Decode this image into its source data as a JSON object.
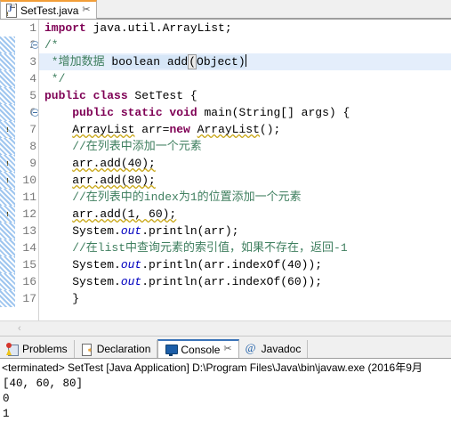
{
  "editor": {
    "tab": {
      "label": "SetTest.java",
      "close_glyph": "✂",
      "icon": "java-file-warning-icon"
    },
    "lines": [
      {
        "n": "1",
        "fold": false,
        "warn": false,
        "diff": false,
        "hl": false,
        "tokens": [
          {
            "t": "import ",
            "c": "kw"
          },
          {
            "t": "java.util.ArrayList;",
            "c": "plain"
          }
        ]
      },
      {
        "n": "2",
        "fold": true,
        "warn": false,
        "diff": true,
        "hl": false,
        "tokens": [
          {
            "t": "/*",
            "c": "cmt"
          }
        ]
      },
      {
        "n": "3",
        "fold": false,
        "warn": false,
        "diff": true,
        "hl": true,
        "tokens": [
          {
            "t": " *增加数据 ",
            "c": "cmt"
          },
          {
            "t": "boolean add",
            "c": "sel-plainblue"
          },
          {
            "t": "(",
            "c": "sel-mbox"
          },
          {
            "t": "Object)",
            "c": "sel-plainblue"
          },
          {
            "t": "|",
            "c": "caret"
          }
        ]
      },
      {
        "n": "4",
        "fold": false,
        "warn": false,
        "diff": true,
        "hl": false,
        "tokens": [
          {
            "t": " */",
            "c": "cmt"
          }
        ]
      },
      {
        "n": "5",
        "fold": false,
        "warn": false,
        "diff": true,
        "hl": false,
        "tokens": [
          {
            "t": "public class ",
            "c": "kw"
          },
          {
            "t": "SetTest {",
            "c": "plain"
          }
        ]
      },
      {
        "n": "6",
        "fold": true,
        "warn": false,
        "diff": true,
        "hl": false,
        "tokens": [
          {
            "t": "    ",
            "c": "plain"
          },
          {
            "t": "public static void ",
            "c": "kw"
          },
          {
            "t": "main(String[] args) {",
            "c": "plain"
          }
        ]
      },
      {
        "n": "7",
        "fold": false,
        "warn": true,
        "diff": true,
        "hl": false,
        "tokens": [
          {
            "t": "    ",
            "c": "plain"
          },
          {
            "t": "ArrayList",
            "c": "squig"
          },
          {
            "t": " arr=",
            "c": "plain"
          },
          {
            "t": "new ",
            "c": "kw"
          },
          {
            "t": "ArrayList",
            "c": "squig"
          },
          {
            "t": "();",
            "c": "plain"
          }
        ]
      },
      {
        "n": "8",
        "fold": false,
        "warn": false,
        "diff": true,
        "hl": false,
        "tokens": [
          {
            "t": "    //在列表中添加一个元素",
            "c": "cmt"
          }
        ]
      },
      {
        "n": "9",
        "fold": false,
        "warn": true,
        "diff": true,
        "hl": false,
        "tokens": [
          {
            "t": "    ",
            "c": "plain"
          },
          {
            "t": "arr.add(40);",
            "c": "squig"
          }
        ]
      },
      {
        "n": "10",
        "fold": false,
        "warn": true,
        "diff": true,
        "hl": false,
        "tokens": [
          {
            "t": "    ",
            "c": "plain"
          },
          {
            "t": "arr.add(80);",
            "c": "squig"
          }
        ]
      },
      {
        "n": "11",
        "fold": false,
        "warn": false,
        "diff": true,
        "hl": false,
        "tokens": [
          {
            "t": "    //在列表中的index为1的位置添加一个元素",
            "c": "cmt"
          }
        ]
      },
      {
        "n": "12",
        "fold": false,
        "warn": true,
        "diff": true,
        "hl": false,
        "tokens": [
          {
            "t": "    ",
            "c": "plain"
          },
          {
            "t": "arr.add(1, 60);",
            "c": "squig"
          }
        ]
      },
      {
        "n": "13",
        "fold": false,
        "warn": false,
        "diff": true,
        "hl": false,
        "tokens": [
          {
            "t": "    System.",
            "c": "plain"
          },
          {
            "t": "out",
            "c": "fld"
          },
          {
            "t": ".println(arr);",
            "c": "plain"
          }
        ]
      },
      {
        "n": "14",
        "fold": false,
        "warn": false,
        "diff": true,
        "hl": false,
        "tokens": [
          {
            "t": "    //在list中查询元素的索引值，如果不存在，返回-1",
            "c": "cmt"
          }
        ]
      },
      {
        "n": "15",
        "fold": false,
        "warn": false,
        "diff": true,
        "hl": false,
        "tokens": [
          {
            "t": "    System.",
            "c": "plain"
          },
          {
            "t": "out",
            "c": "fld"
          },
          {
            "t": ".println(arr.indexOf(40));",
            "c": "plain"
          }
        ]
      },
      {
        "n": "16",
        "fold": false,
        "warn": false,
        "diff": true,
        "hl": false,
        "tokens": [
          {
            "t": "    System.",
            "c": "plain"
          },
          {
            "t": "out",
            "c": "fld"
          },
          {
            "t": ".println(arr.indexOf(60));",
            "c": "plain"
          }
        ]
      },
      {
        "n": "17",
        "fold": false,
        "warn": false,
        "diff": true,
        "hl": false,
        "tokens": [
          {
            "t": "    }",
            "c": "plain"
          }
        ]
      }
    ],
    "hscroll_arrow": "‹"
  },
  "bottom": {
    "tabs": [
      {
        "label": "Problems",
        "icon": "problems-icon",
        "selected": false,
        "closable": false
      },
      {
        "label": "Declaration",
        "icon": "declaration-icon",
        "selected": false,
        "closable": false
      },
      {
        "label": "Console",
        "icon": "console-icon",
        "selected": true,
        "closable": true
      },
      {
        "label": "Javadoc",
        "icon": "javadoc-at-icon",
        "selected": false,
        "closable": false
      }
    ],
    "close_glyph": "✂",
    "console": {
      "terminated_line": "<terminated> SetTest [Java Application] D:\\Program Files\\Java\\bin\\javaw.exe (2016年9月",
      "output": [
        "[40, 60, 80]",
        "0",
        "1"
      ]
    }
  },
  "colors": {
    "keyword": "#7f0055",
    "comment": "#3f7f5f",
    "static_field": "#0000c0",
    "current_line": "#e4eefb",
    "selection": "#d6e6f7",
    "warning": "#f5c842",
    "tab_accent": "#f29e38",
    "view_tab_accent": "#3b74b8"
  }
}
